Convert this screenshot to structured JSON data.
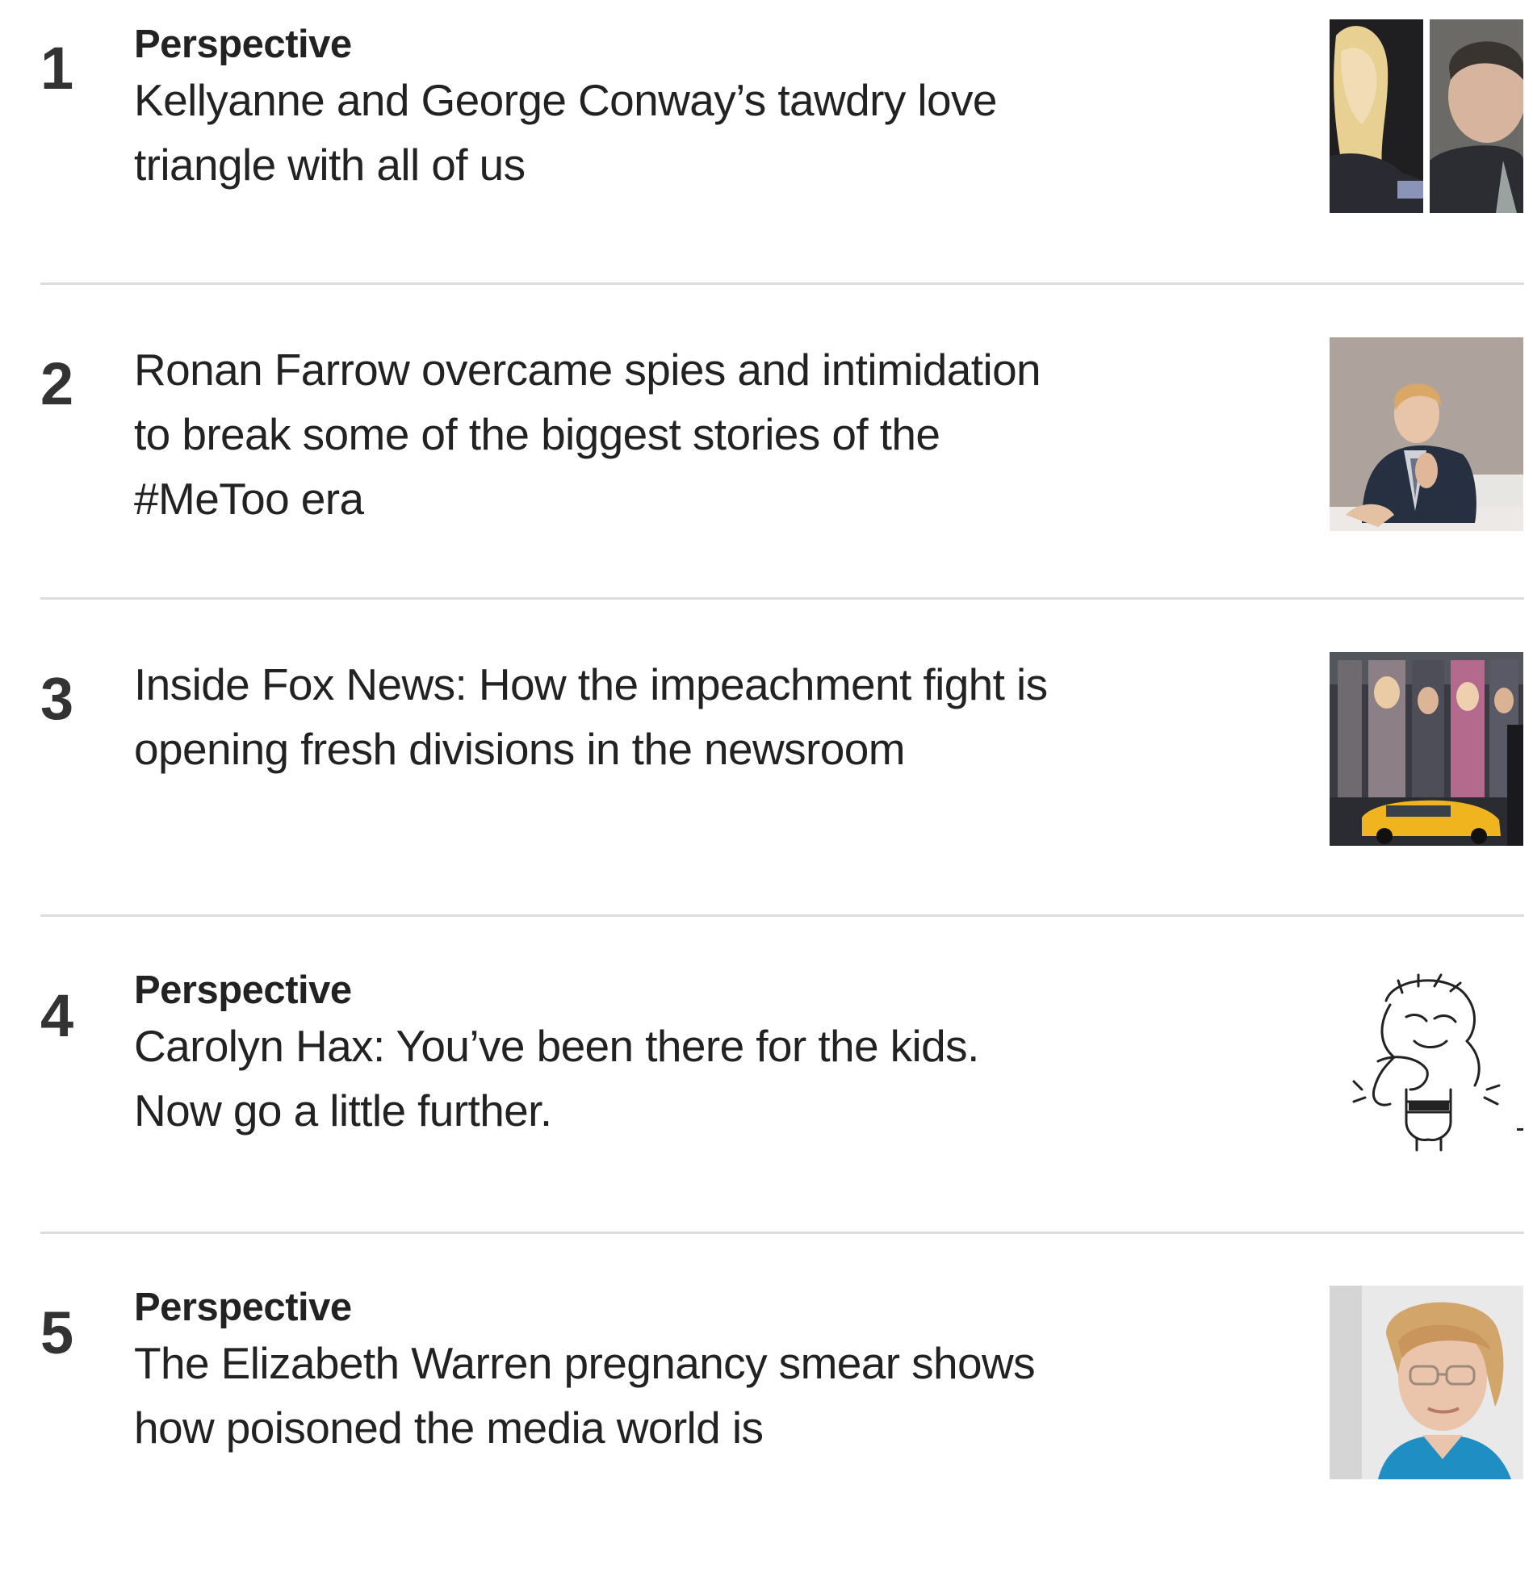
{
  "most_read": {
    "items": [
      {
        "rank": "1",
        "label": "Perspective",
        "headline": "Kellyanne and George Conway’s tawdry love triangle with all of us",
        "thumbnail_icon": "conway-photo"
      },
      {
        "rank": "2",
        "label": "",
        "headline": "Ronan Farrow overcame spies and intimidation to break some of the biggest stories of the #MeToo era",
        "thumbnail_icon": "farrow-photo"
      },
      {
        "rank": "3",
        "label": "",
        "headline": "Inside Fox News: How the impeachment fight is opening fresh divisions in the newsroom",
        "thumbnail_icon": "fox-news-building-photo"
      },
      {
        "rank": "4",
        "label": "Perspective",
        "headline": "Carolyn Hax: You’ve been there for the kids. Now go a little further.",
        "thumbnail_icon": "hax-cartoon-illustration"
      },
      {
        "rank": "5",
        "label": "Perspective",
        "headline": "The Elizabeth Warren pregnancy smear shows how poisoned the media world is",
        "thumbnail_icon": "warren-photo"
      }
    ]
  }
}
